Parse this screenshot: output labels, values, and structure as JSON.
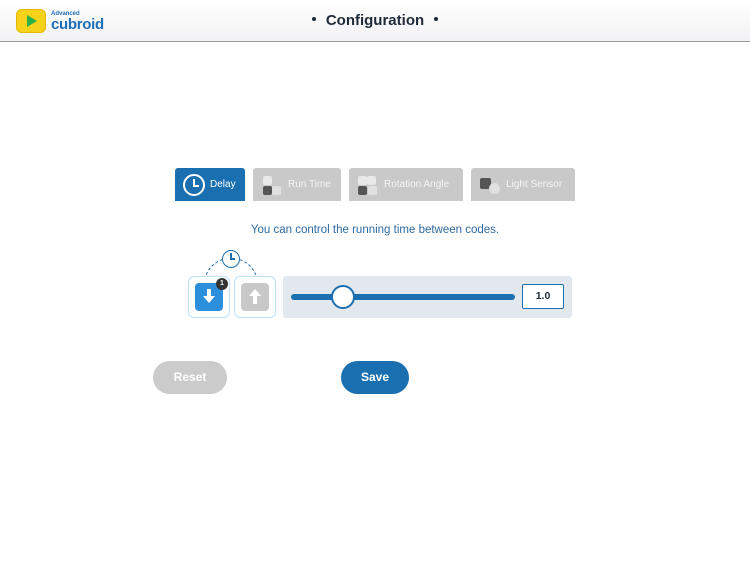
{
  "header": {
    "logo_small": "Advanced",
    "logo_big": "cubroid",
    "title": "Configuration"
  },
  "tabs": [
    {
      "label": "Delay",
      "icon": "clock-icon",
      "active": true
    },
    {
      "label": "Run Time",
      "icon": "cube-runtime-icon",
      "active": false
    },
    {
      "label": "Rotation Angle",
      "icon": "cube-rotation-icon",
      "active": false
    },
    {
      "label": "Light Sensor",
      "icon": "light-sensor-icon",
      "active": false
    }
  ],
  "description": "You can control the running time between codes.",
  "blocks": {
    "first_badge": "1",
    "first_icon": "arrow-down-icon",
    "second_icon": "arrow-up-icon"
  },
  "slider": {
    "value": "1.0",
    "position_fraction": 0.23
  },
  "buttons": {
    "reset": "Reset",
    "save": "Save"
  },
  "colors": {
    "accent": "#1a6fb0",
    "inactive": "#c9c9c9",
    "text_blue": "#2d6aa0"
  }
}
